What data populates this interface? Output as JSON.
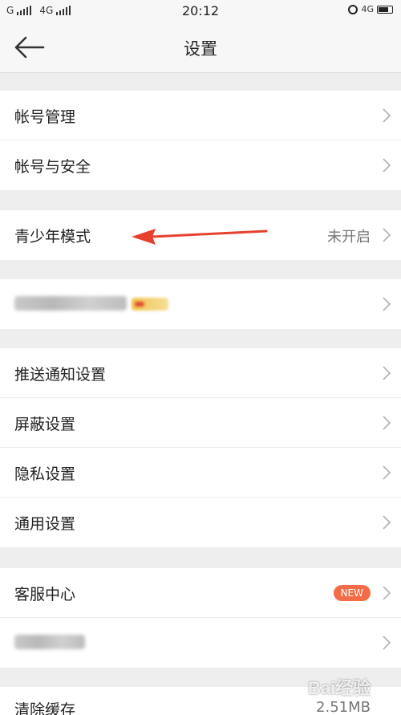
{
  "status_bar": {
    "carrier_1": "G",
    "carrier_2": "4G",
    "time": "20:12",
    "network_right": "4G"
  },
  "header": {
    "title": "设置"
  },
  "groups": [
    {
      "items": [
        {
          "label": "帐号管理"
        },
        {
          "label": "帐号与安全"
        }
      ]
    },
    {
      "items": [
        {
          "label": "青少年模式",
          "value": "未开启"
        }
      ]
    },
    {
      "items": [
        {
          "label": "会员专属设置",
          "blurred": true
        }
      ]
    },
    {
      "items": [
        {
          "label": "推送通知设置"
        },
        {
          "label": "屏蔽设置"
        },
        {
          "label": "隐私设置"
        },
        {
          "label": "通用设置"
        }
      ]
    },
    {
      "items": [
        {
          "label": "客服中心",
          "badge": "NEW"
        },
        {
          "label": "关于微博",
          "blurred": true
        }
      ]
    },
    {
      "items": [
        {
          "label": "清除缓存",
          "value": "2.51MB"
        }
      ]
    }
  ],
  "watermark": {
    "text": "Bai经验"
  },
  "colors": {
    "background": "#eeeeee",
    "accent_badge": "#f26d47",
    "arrow": "#e8402f"
  },
  "icons": {
    "back": "back-arrow-icon",
    "chevron": "chevron-right-icon",
    "alarm": "alarm-clock-icon",
    "battery": "battery-icon"
  }
}
